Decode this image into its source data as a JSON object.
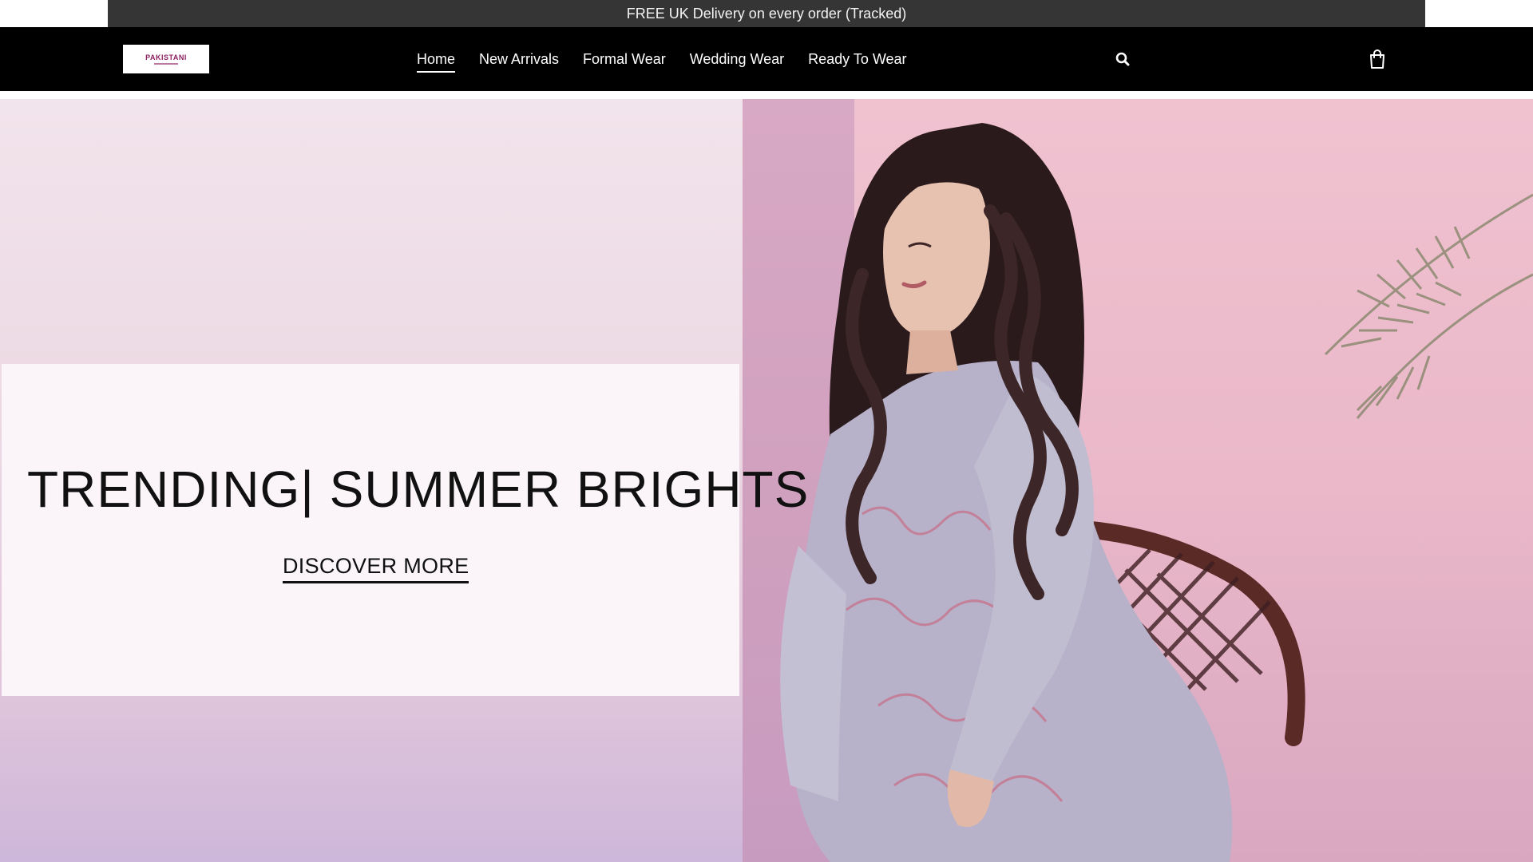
{
  "announcement": {
    "text": "FREE UK Delivery on every order (Tracked)"
  },
  "header": {
    "logo": {
      "text": "PAKISTANI"
    },
    "nav": [
      {
        "label": "Home",
        "active": true
      },
      {
        "label": "New Arrivals",
        "active": false
      },
      {
        "label": "Formal Wear",
        "active": false
      },
      {
        "label": "Wedding Wear",
        "active": false
      },
      {
        "label": "Ready To Wear",
        "active": false
      }
    ],
    "icons": {
      "search": "search-icon",
      "cart": "shopping-bag-icon"
    }
  },
  "hero": {
    "title": "TRENDING| SUMMER BRIGHTS",
    "cta": "DISCOVER MORE"
  },
  "colors": {
    "announcement_bg": "#353535",
    "header_bg": "#000000",
    "logo_accent": "#8d1f63",
    "hero_pink": "#e9b9cc"
  }
}
